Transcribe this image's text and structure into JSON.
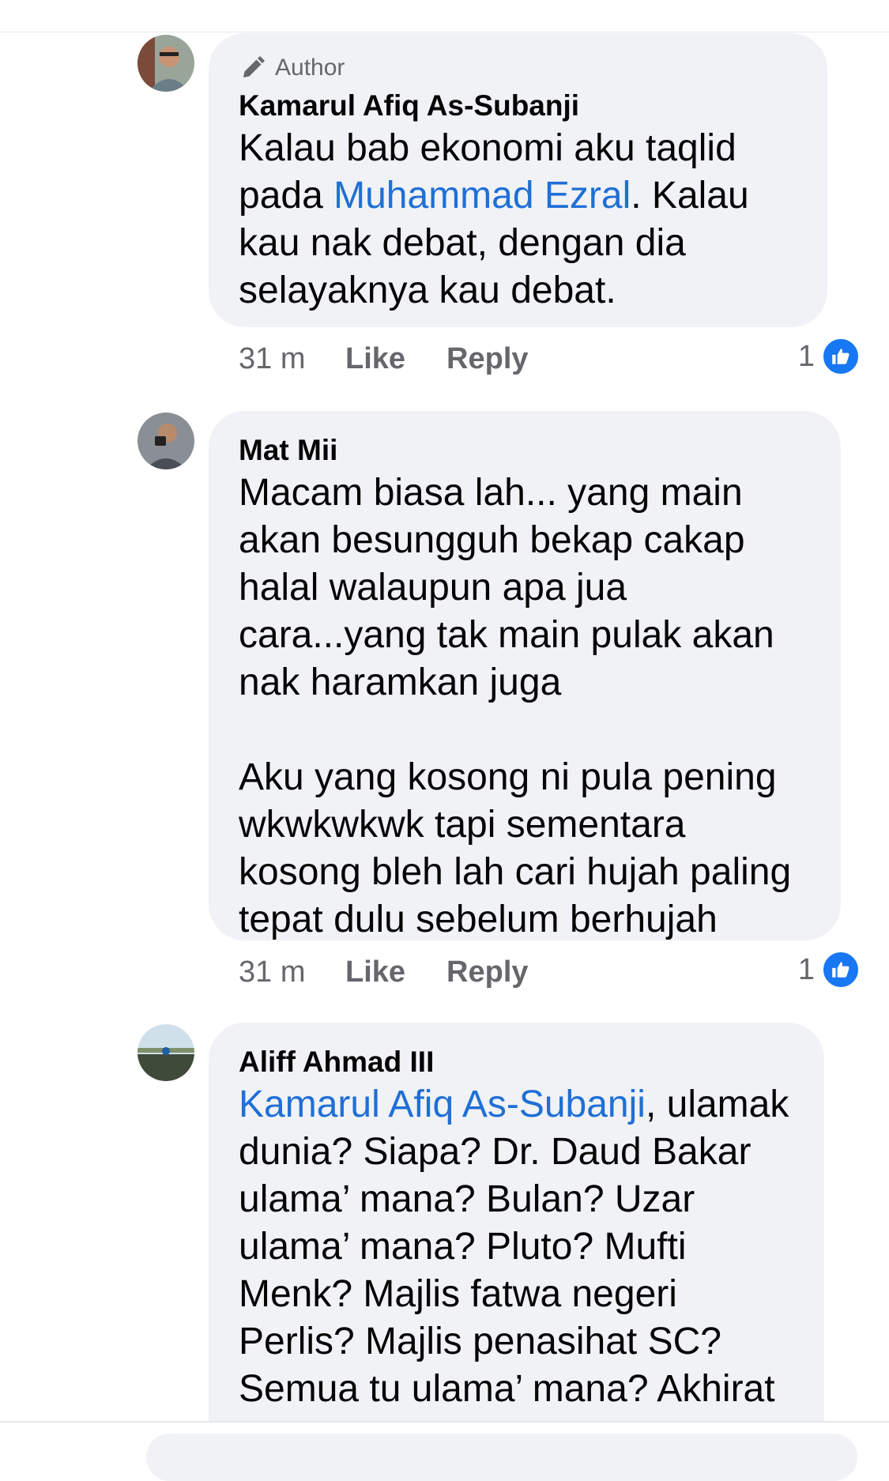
{
  "comments": [
    {
      "badge": "Author",
      "name": "Kamarul Afiq As-Subanji",
      "text_before": "Kalau bab ekonomi aku taqlid pada ",
      "mention": "Muhammad Ezral",
      "text_after": ". Kalau kau nak debat, dengan dia selayaknya kau debat.",
      "time": "31 m",
      "like_label": "Like",
      "reply_label": "Reply",
      "reaction_count": "1"
    },
    {
      "name": "Mat Mii",
      "text": "Macam biasa lah... yang main akan besungguh bekap cakap halal walaupun apa jua cara...yang tak main pulak akan nak haramkan juga\n\nAku yang kosong ni pula pening wkwkwkwk tapi sementara kosong bleh lah cari hujah paling tepat dulu sebelum berhujah",
      "time": "31 m",
      "like_label": "Like",
      "reply_label": "Reply",
      "reaction_count": "1"
    },
    {
      "name": "Aliff Ahmad III",
      "mention": "Kamarul Afiq As-Subanji",
      "text_after": ", ulamak dunia? Siapa? Dr. Daud Bakar ulama’ mana? Bulan? Uzar ulama’ mana? Pluto? Mufti Menk? Majlis fatwa negeri Perlis? Majlis penasihat SC? Semua tu ulama’ mana? Akhirat ke? Kah kah kah.."
    }
  ],
  "colors": {
    "mention": "#1f6fd6",
    "bubble": "#f0f2f5",
    "meta": "#65676b",
    "like_badge": "#1877f2"
  },
  "icons": [
    "pencil-icon",
    "thumbs-up-icon"
  ]
}
